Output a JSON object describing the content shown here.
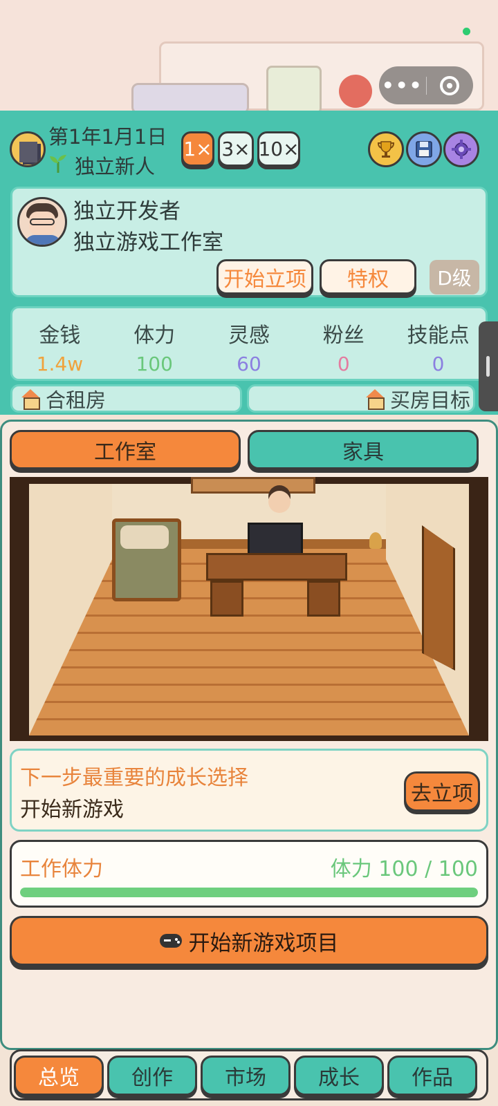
{
  "status": {
    "date": "第1年1月1日",
    "rank": "独立新人"
  },
  "speed": [
    "1×",
    "3×",
    "10×"
  ],
  "player": {
    "name": "独立开发者",
    "studio": "独立游戏工作室",
    "start_project_label": "开始立项",
    "privilege_label": "特权",
    "grade": "D级"
  },
  "stats": [
    {
      "label": "金钱",
      "value": "1.4w",
      "color": "#f0a23c"
    },
    {
      "label": "体力",
      "value": "100",
      "color": "#6ac77b"
    },
    {
      "label": "灵感",
      "value": "60",
      "color": "#8b7fe0"
    },
    {
      "label": "粉丝",
      "value": "0",
      "color": "#e47ca0"
    },
    {
      "label": "技能点",
      "value": "0",
      "color": "#8b7fe0"
    }
  ],
  "home": {
    "current": "合租房",
    "goal": "买房目标"
  },
  "tabs": [
    "工作室",
    "家具"
  ],
  "growth": {
    "title": "下一步最重要的成长选择",
    "subtitle": "开始新游戏",
    "button": "去立项"
  },
  "energy": {
    "label": "工作体力",
    "value_text": "体力 100 / 100",
    "fraction": 1.0
  },
  "start_button": "开始新游戏项目",
  "nav": [
    "总览",
    "创作",
    "市场",
    "成长",
    "作品"
  ],
  "icons": {
    "avatar_small": "city-icon",
    "sprout": "sprout-icon",
    "trophy": "trophy-icon",
    "save": "floppy-disk-icon",
    "settings": "gear-icon",
    "house": "house-icon",
    "gamepad": "gamepad-icon"
  },
  "colors": {
    "primary_teal": "#49c3ae",
    "accent_orange": "#f5883c"
  }
}
